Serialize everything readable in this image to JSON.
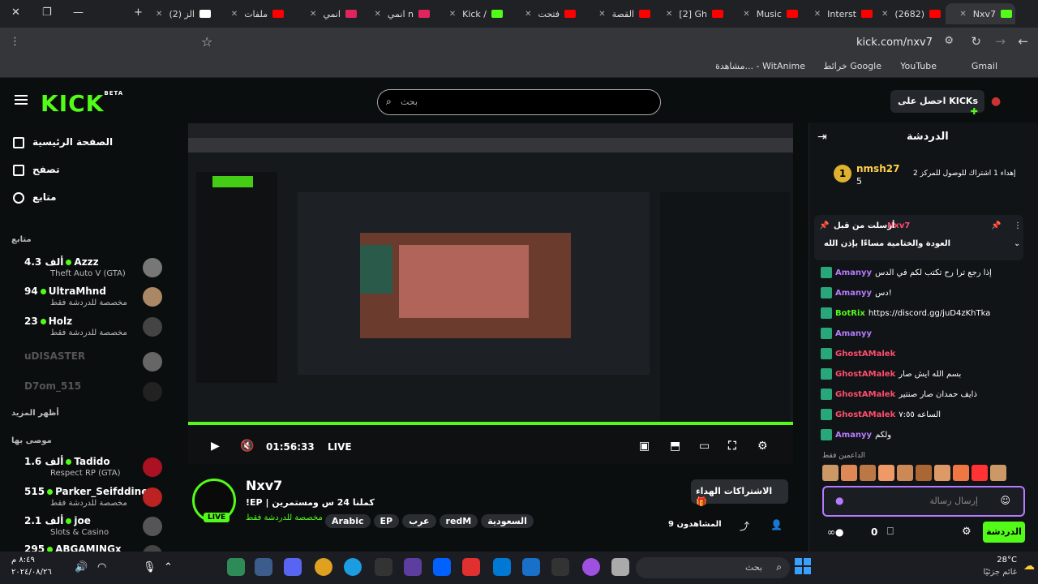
{
  "browser": {
    "tabs": [
      {
        "label": "Nxv7",
        "color": "#53fc18",
        "active": true
      },
      {
        "label": "(2682)",
        "color": "#ff0000"
      },
      {
        "label": "Interst",
        "color": "#ff0000"
      },
      {
        "label": "Music",
        "color": "#ff0000"
      },
      {
        "label": "[2] Gh",
        "color": "#ff0000"
      },
      {
        "label": "القصة",
        "color": "#ff0000"
      },
      {
        "label": "فتحت",
        "color": "#ff0000"
      },
      {
        "label": "Kick /",
        "color": "#53fc18"
      },
      {
        "label": "انمي n",
        "color": "#e0245e"
      },
      {
        "label": "انمي",
        "color": "#e0245e"
      },
      {
        "label": "ملفات",
        "color": "#ff0000"
      },
      {
        "label": "(2) الز",
        "color": "#ffffff"
      }
    ],
    "new_tab": "+",
    "url": "kick.com/nxv7",
    "bookmarks": [
      "Gmail",
      "YouTube",
      "خرائط Google",
      "مشاهدة... - WitAnime"
    ]
  },
  "site": {
    "logo": "KICK",
    "logo_beta": "BETA",
    "search_placeholder": "بحث",
    "get_kicks": "احصل على KICKs",
    "nav": [
      {
        "label": "الصفحة الرئيسية"
      },
      {
        "label": "تصفح"
      },
      {
        "label": "متابع"
      }
    ],
    "following_title": "متابع",
    "following": [
      {
        "name": "Azzz",
        "count": "4.3 ألف",
        "sub": "Theft Auto V (GTA)",
        "online": true,
        "color": "#777"
      },
      {
        "name": "UltraMhnd",
        "count": "94",
        "sub": "مخصصة للدردشة فقط",
        "online": true,
        "color": "#aa8866"
      },
      {
        "name": "Holz",
        "count": "23",
        "sub": "مخصصة للدردشة فقط",
        "online": true,
        "color": "#444"
      },
      {
        "name": "uDISASTER",
        "count": "",
        "sub": "",
        "online": false,
        "color": "#666"
      },
      {
        "name": "D7om_515",
        "count": "",
        "sub": "",
        "online": false,
        "color": "#222"
      }
    ],
    "show_more": "أظهر المزيد",
    "recommended_title": "موصى بها",
    "recommended": [
      {
        "name": "Tadido",
        "count": "1.6 ألف",
        "sub": "Respect RP (GTA)",
        "color": "#aa1122"
      },
      {
        "name": "Parker_Seifddine",
        "count": "515",
        "sub": "مخصصة للدردشة فقط",
        "color": "#bb2222"
      },
      {
        "name": "joe",
        "count": "2.1 ألف",
        "sub": "Slots & Casino",
        "color": "#555"
      },
      {
        "name": "ABGAMINGx",
        "count": "295",
        "sub": "",
        "color": "#444"
      }
    ]
  },
  "player": {
    "time": "01:56:33",
    "live": "LIVE"
  },
  "stream": {
    "streamer": "Nxv7",
    "live_badge": "LIVE",
    "title": "كملنا 24 س ومستمرين | EP!",
    "category": "مخصصة للدردشة فقط",
    "tags": [
      "السعودية",
      "redM",
      "عرب",
      "EP",
      "Arabic"
    ],
    "gift_btn": "الاشتراكات الهداء",
    "viewers": "المشاهدون 9"
  },
  "chat": {
    "title": "الدردشة",
    "leader_name": "nmsh27",
    "leader_count": "5",
    "leader_text": "إهداء 1 اشتراك للوصول للمركز 2",
    "pinned_user": "Nxv7",
    "pinned_label": "أرسلت من قبل",
    "pinned_text": "العودة والختامية مساءًا بإذن الله",
    "messages": [
      {
        "user": "Amanyy",
        "text": "إذا رجع ترا رح تكتب لكم في الدس",
        "color": "#b57bff"
      },
      {
        "user": "Amanyy",
        "text": "دس!",
        "color": "#b57bff"
      },
      {
        "user": "BotRix",
        "text": "https://discord.gg/juD4zKhTka",
        "color": "#53fc18"
      },
      {
        "user": "Amanyy",
        "text": "",
        "color": "#b57bff"
      },
      {
        "user": "GhostAMalek",
        "text": "",
        "color": "#ff4d6d"
      },
      {
        "user": "GhostAMalek",
        "text": "بسم الله ايش صار",
        "color": "#ff4d6d"
      },
      {
        "user": "GhostAMalek",
        "text": "ذايف حمدان صار صنتير",
        "color": "#ff4d6d"
      },
      {
        "user": "GhostAMalek",
        "text": "الساعه ٧:٥٥",
        "color": "#ff4d6d"
      },
      {
        "user": "Amanyy",
        "text": "ولكم",
        "color": "#b57bff"
      }
    ],
    "supporters": "الداعمين فقط",
    "input_placeholder": "إرسال رسالة",
    "send": "الدردشة",
    "points": "0"
  },
  "taskbar": {
    "weather_temp": "28°C",
    "weather_desc": "غائم جزئيًا",
    "search": "بحث",
    "time": "٨:٤٩ م",
    "date": "٢٠٢٤/٠٨/٢٦"
  }
}
